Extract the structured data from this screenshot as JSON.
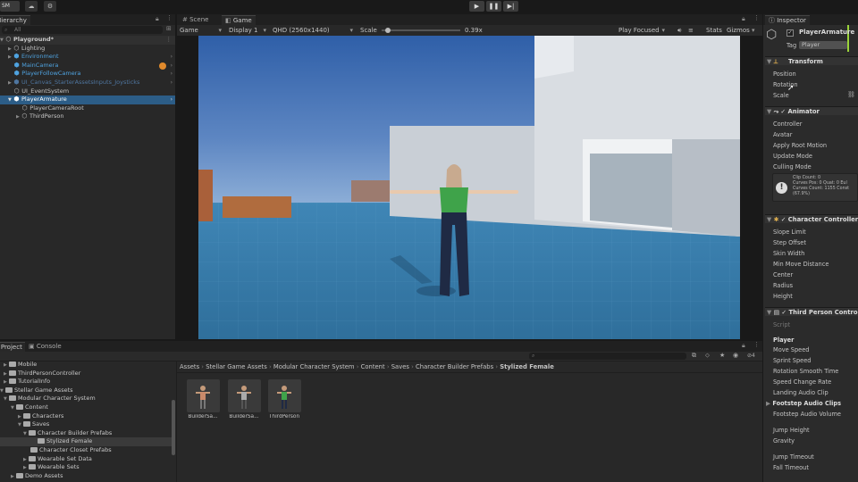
{
  "toolbar": {
    "account": "SM",
    "cloud_icon": "cloud-icon",
    "settings_icon": "gear-icon",
    "play_icon": "play-icon",
    "pause_icon": "pause-icon",
    "step_icon": "step-icon"
  },
  "hierarchy": {
    "tab": "Hierarchy",
    "search_placeholder": "All",
    "items": [
      {
        "label": "Playground*"
      },
      {
        "label": "Lighting"
      },
      {
        "label": "Environment"
      },
      {
        "label": "MainCamera"
      },
      {
        "label": "PlayerFollowCamera"
      },
      {
        "label": "UI_Canvas_StarterAssetsInputs_Joysticks"
      },
      {
        "label": "UI_EventSystem"
      },
      {
        "label": "PlayerArmature"
      },
      {
        "label": "PlayerCameraRoot"
      },
      {
        "label": "ThirdPerson"
      }
    ]
  },
  "center_tabs": {
    "scene": "Scene",
    "game": "Game"
  },
  "game_bar": {
    "mode": "Game",
    "display": "Display 1",
    "resolution": "QHD (2560x1440)",
    "scale_label": "Scale",
    "scale_value": "0.39x",
    "scale_level": 0.05,
    "play_focused": "Play Focused",
    "stats": "Stats",
    "gizmos": "Gizmos"
  },
  "inspector": {
    "tab": "Inspector",
    "object_name": "PlayerArmature",
    "tag_label": "Tag",
    "tag_value": "Player",
    "transform": {
      "title": "Transform",
      "fields": [
        "Position",
        "Rotation",
        "Scale"
      ]
    },
    "animator": {
      "title": "Animator",
      "fields": [
        "Controller",
        "Avatar",
        "Apply Root Motion",
        "Update Mode",
        "Culling Mode"
      ],
      "info_lines": [
        "Clip Count: 0",
        "Curves Pos: 0 Quat: 0 Eul",
        "Curves Count: 1155 Const",
        "(67.9%)"
      ]
    },
    "character_controller": {
      "title": "Character Controller",
      "fields": [
        "Slope Limit",
        "Step Offset",
        "Skin Width",
        "Min Move Distance",
        "Center",
        "Radius",
        "Height"
      ]
    },
    "third_person": {
      "title": "Third Person Controller",
      "script_label": "Script",
      "section_player": "Player",
      "fields": [
        "Move Speed",
        "Sprint Speed",
        "Rotation Smooth Time",
        "Speed Change Rate",
        "Landing Audio Clip"
      ],
      "foldout": "Footstep Audio Clips",
      "fields2": [
        "Footstep Audio Volume"
      ],
      "fields3": [
        "Jump Height",
        "Gravity"
      ],
      "fields4": [
        "Jump Timeout",
        "Fall Timeout"
      ]
    }
  },
  "project": {
    "tabs": {
      "project": "Project",
      "console": "Console"
    },
    "tree": [
      {
        "label": "Mobile",
        "indent": 1
      },
      {
        "label": "ThirdPersonController",
        "indent": 1
      },
      {
        "label": "TutorialInfo",
        "indent": 1
      },
      {
        "label": "Stellar Game Assets",
        "indent": 0
      },
      {
        "label": "Modular Character System",
        "indent": 1
      },
      {
        "label": "Content",
        "indent": 2
      },
      {
        "label": "Characters",
        "indent": 3
      },
      {
        "label": "Saves",
        "indent": 3
      },
      {
        "label": "Character Builder Prefabs",
        "indent": 4
      },
      {
        "label": "Stylized Female",
        "indent": 5
      },
      {
        "label": "Character Closet Prefabs",
        "indent": 4
      },
      {
        "label": "Wearable Set Data",
        "indent": 4
      },
      {
        "label": "Wearable Sets",
        "indent": 4
      },
      {
        "label": "Demo Assets",
        "indent": 2
      }
    ],
    "breadcrumb": [
      "Assets",
      "Stellar Game Assets",
      "Modular Character System",
      "Content",
      "Saves",
      "Character Builder Prefabs",
      "Stylized Female"
    ],
    "assets": [
      {
        "label": "BuilderSa..."
      },
      {
        "label": "BuilderSa..."
      },
      {
        "label": "ThirdPerson"
      }
    ],
    "count": "4"
  }
}
